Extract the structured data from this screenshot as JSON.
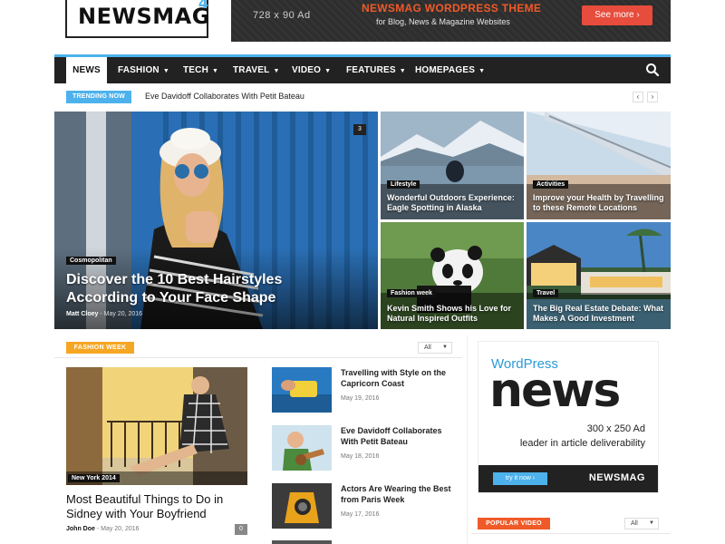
{
  "header": {
    "logo_text": "NEWSMAG",
    "logo_superscript": "4",
    "ad": {
      "size_label": "728 x 90 Ad",
      "title": "NEWSMAG WORDPRESS THEME",
      "subtitle": "for Blog, News & Magazine Websites",
      "button_label": "See more ›"
    }
  },
  "nav": {
    "items": [
      {
        "label": "NEWS",
        "active": true
      },
      {
        "label": "FASHION",
        "caret": "▼"
      },
      {
        "label": "TECH",
        "caret": "▼"
      },
      {
        "label": "TRAVEL",
        "caret": "▼"
      },
      {
        "label": "VIDEO",
        "caret": "▼"
      },
      {
        "label": "FEATURES",
        "caret": "▼"
      },
      {
        "label": "HOMEPAGES",
        "caret": "▼"
      }
    ],
    "search_icon": "search-icon"
  },
  "trending": {
    "badge": "TRENDING NOW",
    "headline": "Eve Davidoff Collaborates With Petit Bateau",
    "prev": "‹",
    "next": "›"
  },
  "featured": {
    "main": {
      "category": "Cosmopolitan",
      "title": "Discover the 10 Best Hairstyles According to Your Face Shape",
      "author": "Matt Cloey",
      "date": "May 20, 2016",
      "comments": "3"
    },
    "tiles": [
      {
        "category": "Lifestyle",
        "title": "Wonderful Outdoors Experience: Eagle Spotting in Alaska"
      },
      {
        "category": "Activities",
        "title": "Improve your Health by Travelling to these Remote Locations"
      },
      {
        "category": "Fashion week",
        "title": "Kevin Smith Shows his Love for Natural Inspired Outfits"
      },
      {
        "category": "Travel",
        "title": "The Big Real Estate Debate: What Makes A Good Investment"
      }
    ]
  },
  "fashion_week": {
    "badge": "FASHION WEEK",
    "filter": "All",
    "main_post": {
      "category": "New York 2014",
      "title": "Most Beautiful Things to Do in Sidney with Your Boyfriend",
      "author": "John Doe",
      "date": "May 20, 2016",
      "comments": "0"
    },
    "list": [
      {
        "title": "Travelling with Style on the Capricorn Coast",
        "date": "May 19, 2016"
      },
      {
        "title": "Eve Davidoff Collaborates With Petit Bateau",
        "date": "May 18, 2016"
      },
      {
        "title": "Actors Are Wearing the Best from Paris Week",
        "date": "May 17, 2016"
      }
    ]
  },
  "side_ad": {
    "wp": "WordPress",
    "news": "news",
    "size": "300 x 250 Ad",
    "sub": "leader in article deliverability",
    "button": "try it now ›",
    "brand": "NEWSMAG"
  },
  "popular_video": {
    "badge": "POPULAR VIDEO",
    "filter": "All"
  },
  "colors": {
    "accent": "#4db2ec",
    "nav_bg": "#222222",
    "fashion_badge": "#f5a623",
    "video_badge": "#f05a28",
    "ad_button": "#e74c3c"
  }
}
